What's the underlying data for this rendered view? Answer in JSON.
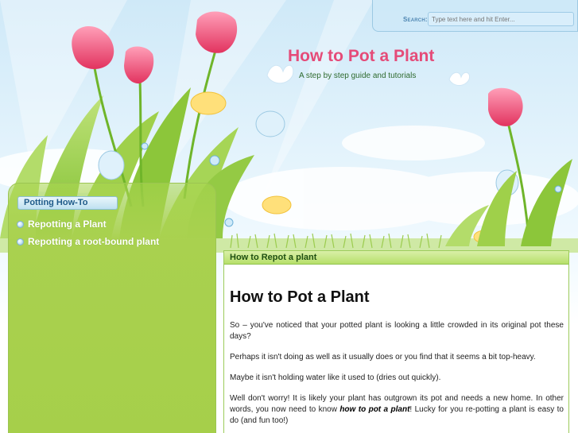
{
  "search": {
    "label": "Search:",
    "placeholder": "Type text here and hit Enter..."
  },
  "site": {
    "title": "How to Pot a Plant",
    "tagline": "A step by step guide and tutorials"
  },
  "sidebar": {
    "heading": "Potting How-To",
    "items": [
      {
        "label": "Repotting a Plant"
      },
      {
        "label": "Repotting a root-bound plant"
      }
    ]
  },
  "main": {
    "tab_label": "How to Repot a plant",
    "article_title": "How to Pot a Plant",
    "paragraphs": [
      "So – you've noticed that your potted plant is looking a little crowded in its original pot these days?",
      "Perhaps it isn't doing as well as it usually does or you find that it seems a bit top-heavy.",
      "Maybe it isn't holding water like it used to (dries out quickly)."
    ],
    "last_paragraph": {
      "before": "Well don't worry!  It is likely your plant has outgrown its pot and needs a new home.  In other words, you now need to know ",
      "emphasis": "how to pot a plant",
      "after": "! Lucky for you re-potting a plant is easy to do (and fun too!)"
    }
  },
  "colors": {
    "title_pink": "#e54b78",
    "sidebar_green": "#a9d14f",
    "tab_green": "#b7df6a",
    "heading_blue": "#1f5b8a"
  }
}
